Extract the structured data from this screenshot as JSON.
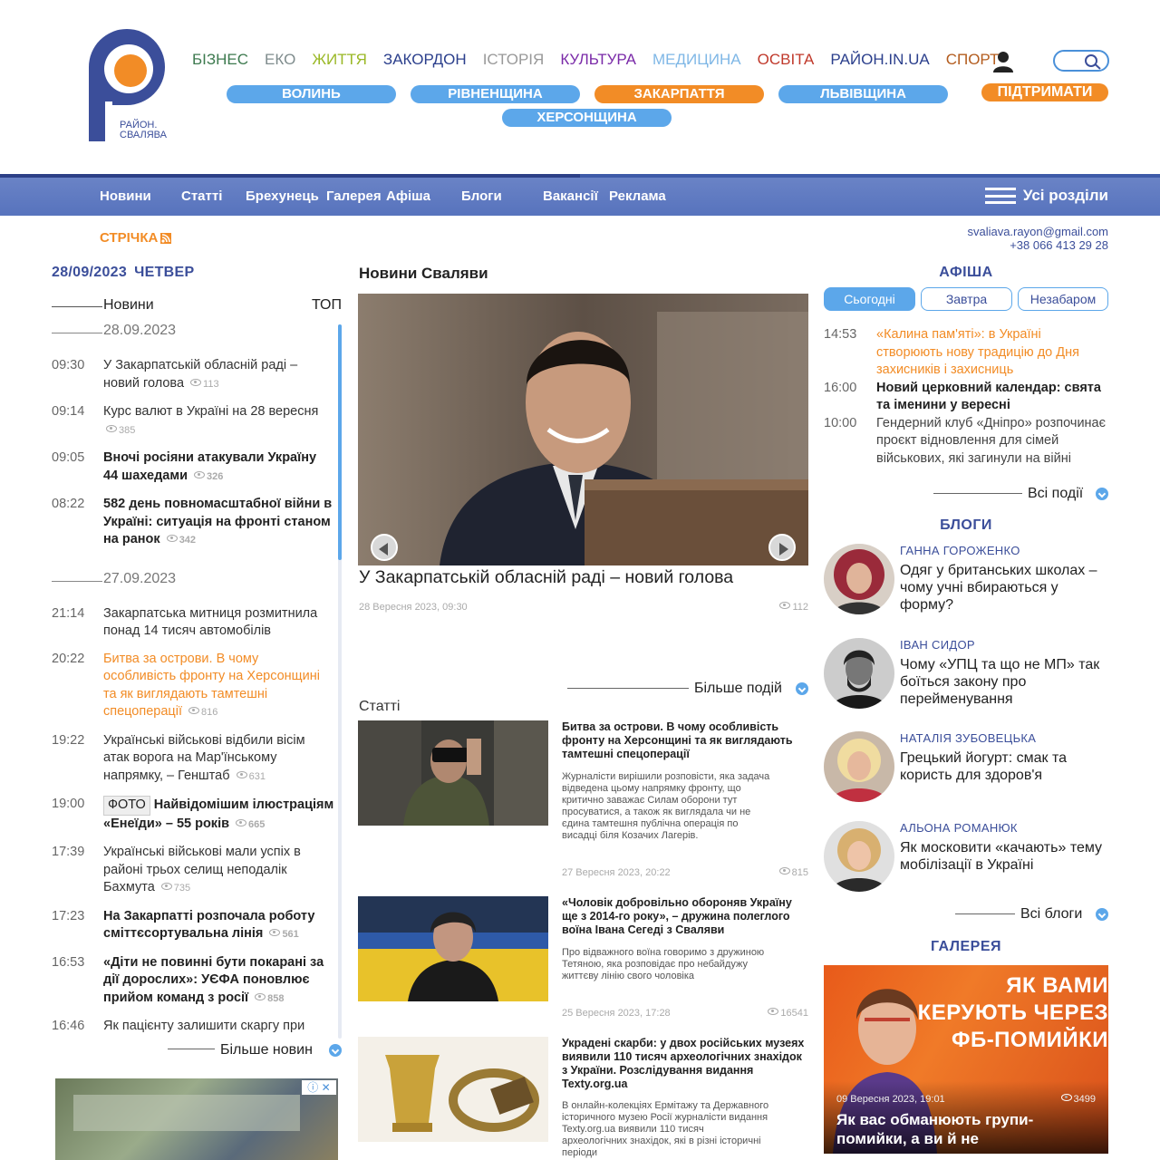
{
  "brand": {
    "city_line1": "РАЙОН.",
    "city_line2": "СВАЛЯВА"
  },
  "categories": [
    {
      "label": "БІЗНЕС",
      "color": "#3d7a4f"
    },
    {
      "label": "ЕКО",
      "color": "#7f8c8d"
    },
    {
      "label": "ЖИТТЯ",
      "color": "#9ab826"
    },
    {
      "label": "ЗАКОРДОН",
      "color": "#2b3f8c"
    },
    {
      "label": "ІСТОРІЯ",
      "color": "#999999"
    },
    {
      "label": "КУЛЬТУРА",
      "color": "#7a2aa8"
    },
    {
      "label": "МЕДИЦИНА",
      "color": "#7fb7e6"
    },
    {
      "label": "ОСВІТА",
      "color": "#c0392b"
    },
    {
      "label": "РАЙОН.IN.UA",
      "color": "#2b3f8c"
    },
    {
      "label": "СПОРТ",
      "color": "#b35c1e"
    }
  ],
  "regions": [
    "ВОЛИНЬ",
    "РІВНЕНЩИНА",
    "ЗАКАРПАТТЯ",
    "ЛЬВІВЩИНА",
    "ХЕРСОНЩИНА"
  ],
  "support_label": "ПІДТРИМАТИ",
  "nav": {
    "items": [
      "Новини",
      "Статті",
      "Брехунець",
      "Галерея",
      "Афіша",
      "Блоги",
      "Вакансії",
      "Реклама"
    ],
    "all_sections": "Усі розділи"
  },
  "feed_label": "СТРІЧКА",
  "contacts": {
    "email": "svaliava.rayon@gmail.com",
    "phone": "+38 066 413 29 28"
  },
  "date": {
    "value": "28/09/2023",
    "weekday": "ЧЕТВЕР"
  },
  "feed_tabs": {
    "news": "Новини",
    "top": "ТОП"
  },
  "feed": {
    "day1": "28.09.2023",
    "day2": "27.09.2023",
    "items_day1": [
      {
        "time": "09:30",
        "text": "У Закарпатській обласній раді – новий голова",
        "views": "113",
        "style": "plain"
      },
      {
        "time": "09:14",
        "text": "Курс валют в Україні на 28 вересня",
        "views": "385",
        "style": "plain"
      },
      {
        "time": "09:05",
        "text": "Вночі росіяни атакували Україну 44 шахедами",
        "views": "326",
        "style": "bold"
      },
      {
        "time": "08:22",
        "text": "582 день повномасштабної війни в Україні: ситуація на фронті станом на ранок",
        "views": "342",
        "style": "bold"
      }
    ],
    "items_day2": [
      {
        "time": "21:14",
        "text": "Закарпатська митниця розмитнила понад 14 тисяч автомобілів",
        "views": "",
        "style": "plain"
      },
      {
        "time": "20:22",
        "text": "Битва за острови. В чому особливість фронту на Херсонщині та як виглядають тамтешні спецоперації",
        "views": "816",
        "style": "orange"
      },
      {
        "time": "19:22",
        "text": "Українські військові відбили вісім атак ворога на Мар'їнському напрямку, – Генштаб",
        "views": "631",
        "style": "plain"
      },
      {
        "time": "19:00",
        "badge": "ФОТО",
        "text": "Найвідомішим ілюстраціям «Енеїди» – 55 років",
        "views": "665",
        "style": "bold"
      },
      {
        "time": "17:39",
        "text": "Українські військові мали успіх в районі трьох селищ неподалік Бахмута",
        "views": "735",
        "style": "plain"
      },
      {
        "time": "17:23",
        "text": "На Закарпатті розпочала роботу сміттєсортувальна лінія",
        "views": "561",
        "style": "bold"
      },
      {
        "time": "16:53",
        "text": "«Діти не повинні бути покарані за дії дорослих»: УЄФА поновлює прийом команд з росії",
        "views": "858",
        "style": "bold"
      },
      {
        "time": "16:46",
        "text": "Як пацієнту залишити скаргу при",
        "views": "",
        "style": "plain"
      }
    ],
    "more": "Більше новин"
  },
  "ad": {
    "marker": "ⓘ ✕"
  },
  "main": {
    "title": "Новини Сваляви",
    "hero": {
      "title": "У Закарпатській обласній раді – новий голова",
      "date": "28 Вересня 2023, 09:30",
      "views": "112"
    },
    "more_events": "Більше подій",
    "articles_label": "Статті",
    "articles": [
      {
        "title": "Битва за острови. В чому особливість фронту на Херсонщині та як виглядають тамтешні спецоперації",
        "desc": "Журналісти вирішили розповісти, яка задача відведена цьому напрямку фронту, що критично заважає Силам оборони тут просуватися, а також як виглядала чи не єдина тамтешня публічна операція по висадці біля Козачих Лагерів.",
        "date": "27 Вересня 2023, 20:22",
        "views": "815"
      },
      {
        "title": "«Чоловік добровільно обороняв Україну ще з 2014-го року», – дружина полеглого воїна Івана Сегеді з Сваляви",
        "desc": "Про відважного воїна говоримо з дружиною Тетяною, яка розповідає про небайдужу життєву лінію свого чоловіка",
        "date": "25 Вересня 2023, 17:28",
        "views": "16541"
      },
      {
        "title": "Украдені скарби: у двох російських музеях виявили 110 тисяч археологічних знахідок з України. Розслідування видання Texty.org.ua",
        "desc": "В онлайн-колекціях Ермітажу та Державного історичного музею Росії журналісти видання Texty.org.ua виявили 110 тисяч археологічних знахідок, які в різні історичні періоди",
        "date": "",
        "views": ""
      }
    ]
  },
  "afisha": {
    "title": "АФІША",
    "tabs": [
      "Сьогодні",
      "Завтра",
      "Незабаром"
    ],
    "events": [
      {
        "time": "14:53",
        "text": "«Калина пам'яті»: в Україні створюють нову традицію до Дня захисників і захисниць",
        "style": "orange"
      },
      {
        "time": "16:00",
        "text": "Новий церковний календар: свята та іменини у вересні",
        "style": "bold"
      },
      {
        "time": "10:00",
        "text": "Гендерний клуб «Дніпро» розпочинає проєкт відновлення для сімей військових, які загинули на війні",
        "style": "plain"
      }
    ],
    "all_events": "Всі події"
  },
  "blogs": {
    "title": "БЛОГИ",
    "items": [
      {
        "author": "ГАННА ГОРОЖЕНКО",
        "title": "Одяг у британських школах – чому учні вбираються у форму?"
      },
      {
        "author": "ІВАН СИДОР",
        "title": "Чому «УПЦ та що не МП» так боїться закону про перейменування"
      },
      {
        "author": "НАТАЛІЯ ЗУБОВЕЦЬКА",
        "title": "Грецький йогурт: смак та користь для здоров'я"
      },
      {
        "author": "АЛЬОНА РОМАНЮК",
        "title": "Як московити «качають» тему мобілізації в Україні"
      }
    ],
    "all_blogs": "Всі блоги"
  },
  "gallery": {
    "title": "ГАЛЕРЕЯ",
    "overlay_text": "ЯК ВАМИ КЕРУЮТЬ ЧЕРЕЗ ФБ-ПОМИЙКИ",
    "date": "09 Вересня 2023, 19:01",
    "views": "3499",
    "caption": "Як вас обманюють групи-помийки, а ви й не"
  },
  "colors": {
    "brand_blue": "#3b4e9a",
    "accent_orange": "#f28c26",
    "light_blue": "#5ca7ea"
  }
}
